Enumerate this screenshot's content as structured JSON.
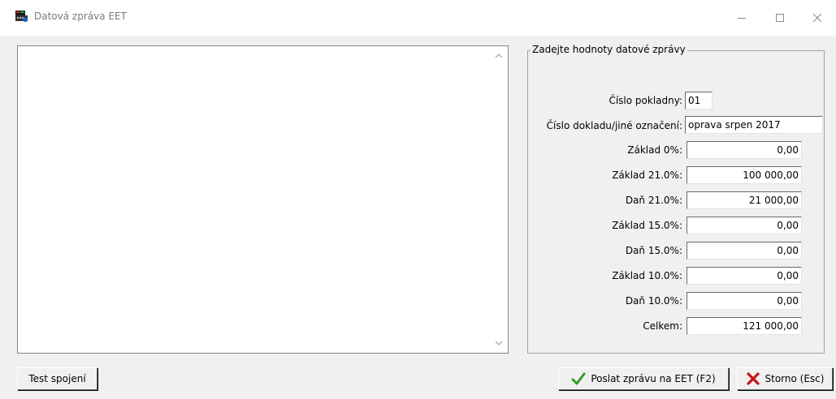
{
  "window": {
    "title": "Datová zpráva EET",
    "icon": "eet-cash-register-icon"
  },
  "groupbox": {
    "legend": "Zadejte hodnoty datové zprávy"
  },
  "fields": {
    "cislo_pokladny": {
      "label": "Číslo pokladny:",
      "value": "01"
    },
    "cislo_dokladu": {
      "label": "Číslo dokladu/jiné označení:",
      "value": "oprava srpen 2017"
    },
    "zaklad_0": {
      "label": "Základ 0%:",
      "value": "0,00"
    },
    "zaklad_21": {
      "label": "Základ 21.0%:",
      "value": "100 000,00"
    },
    "dan_21": {
      "label": "Daň 21.0%:",
      "value": "21 000,00"
    },
    "zaklad_15": {
      "label": "Základ 15.0%:",
      "value": "0,00"
    },
    "dan_15": {
      "label": "Daň 15.0%:",
      "value": "0,00"
    },
    "zaklad_10": {
      "label": "Základ 10.0%:",
      "value": "0,00"
    },
    "dan_10": {
      "label": "Daň 10.0%:",
      "value": "0,00"
    },
    "celkem": {
      "label": "Celkem:",
      "value": "121 000,00"
    }
  },
  "buttons": {
    "test": "Test spojení",
    "send": "Poslat zprávu na EET (F2)",
    "cancel": "Storno (Esc)"
  },
  "colors": {
    "check_green": "#2e9c2e",
    "cross_red": "#c81414"
  }
}
